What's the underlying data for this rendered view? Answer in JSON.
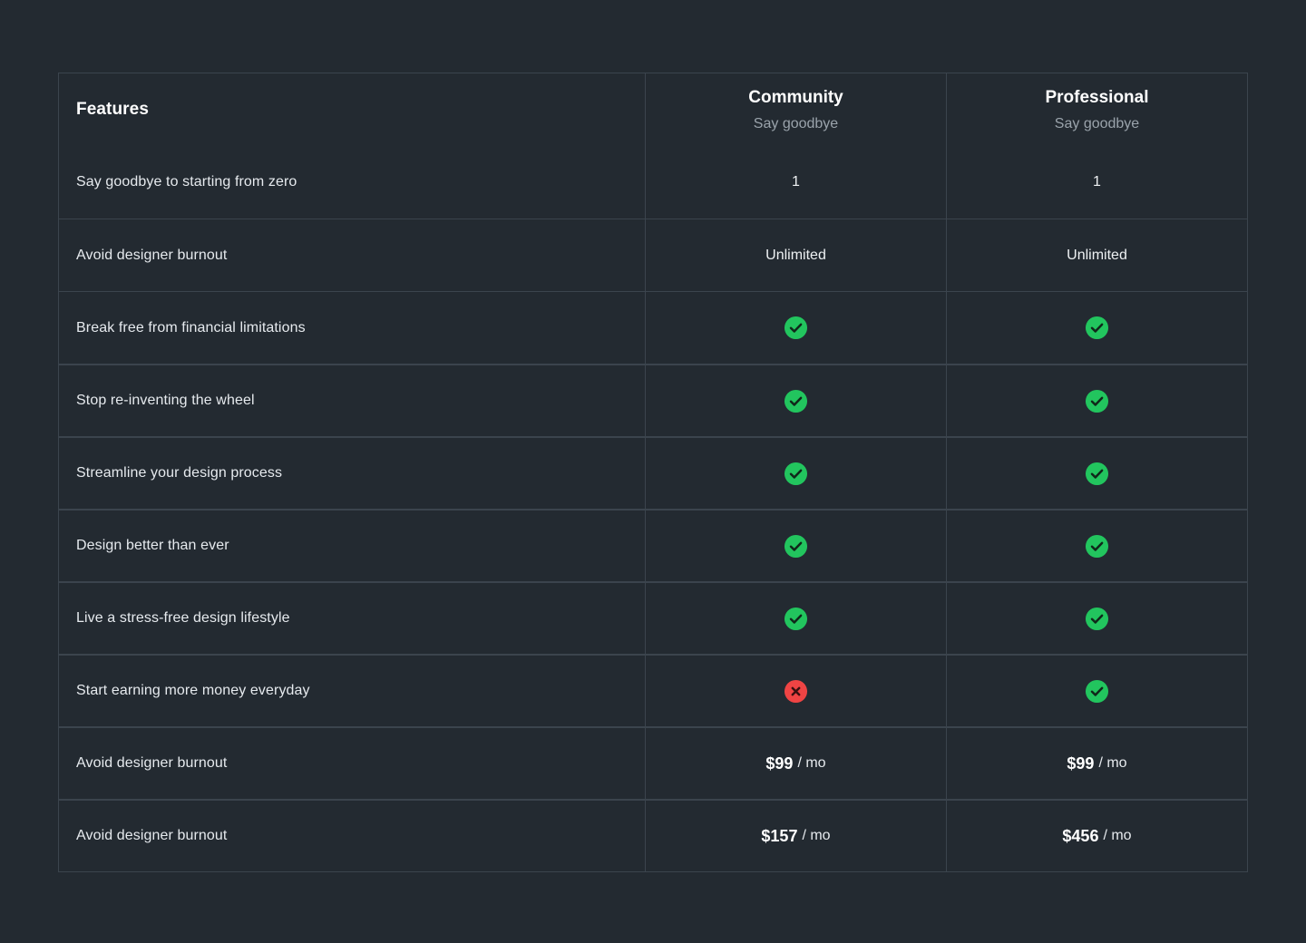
{
  "colors": {
    "background": "#232a31",
    "border": "#3b444d",
    "check": "#22c55e",
    "cross": "#ef4444"
  },
  "header": {
    "features_label": "Features",
    "plans": [
      {
        "name": "Community",
        "subtitle": "Say goodbye"
      },
      {
        "name": "Professional",
        "subtitle": "Say goodbye"
      }
    ]
  },
  "rows": [
    {
      "feature": "Say goodbye to starting from zero",
      "values": [
        {
          "type": "text",
          "text": "1"
        },
        {
          "type": "text",
          "text": "1"
        }
      ]
    },
    {
      "feature": "Avoid designer burnout",
      "values": [
        {
          "type": "text",
          "text": "Unlimited"
        },
        {
          "type": "text",
          "text": "Unlimited"
        }
      ]
    },
    {
      "feature": "Break free from financial limitations",
      "values": [
        {
          "type": "check-icon"
        },
        {
          "type": "check-icon"
        }
      ]
    },
    {
      "feature": "Stop re-inventing the wheel",
      "values": [
        {
          "type": "check-icon"
        },
        {
          "type": "check-icon"
        }
      ]
    },
    {
      "feature": "Streamline your design process",
      "values": [
        {
          "type": "check-icon"
        },
        {
          "type": "check-icon"
        }
      ]
    },
    {
      "feature": "Design better than ever",
      "values": [
        {
          "type": "check-icon"
        },
        {
          "type": "check-icon"
        }
      ]
    },
    {
      "feature": "Live a stress-free design lifestyle",
      "values": [
        {
          "type": "check-icon"
        },
        {
          "type": "check-icon"
        }
      ]
    },
    {
      "feature": "Start earning more money everyday",
      "values": [
        {
          "type": "cross-icon"
        },
        {
          "type": "check-icon"
        }
      ]
    },
    {
      "feature": "Avoid designer burnout",
      "values": [
        {
          "type": "price",
          "amount": "$99",
          "unit": "/ mo"
        },
        {
          "type": "price",
          "amount": "$99",
          "unit": "/ mo"
        }
      ]
    },
    {
      "feature": "Avoid designer burnout",
      "values": [
        {
          "type": "price",
          "amount": "$157",
          "unit": "/ mo"
        },
        {
          "type": "price",
          "amount": "$456",
          "unit": "/ mo"
        }
      ]
    }
  ]
}
